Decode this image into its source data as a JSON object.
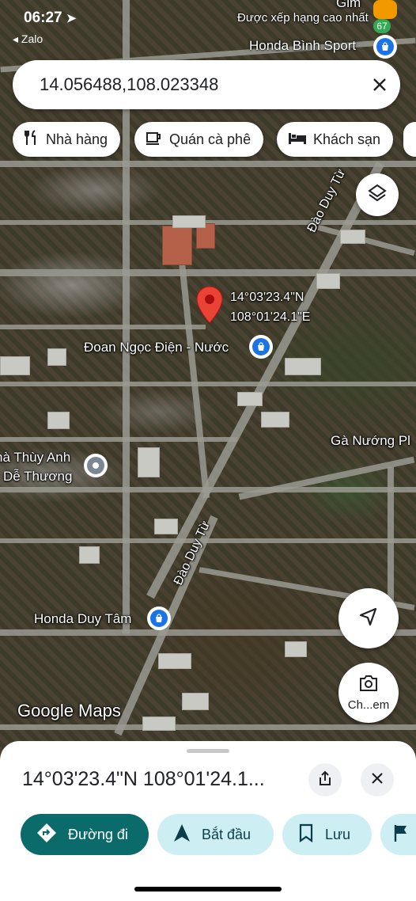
{
  "status_bar": {
    "time": "06:27",
    "back_app": "◂ Zalo",
    "top_right_text": "Được xếp hạng cao nhất",
    "badge_count": "67"
  },
  "search": {
    "value": "14.056488,108.023348"
  },
  "chips": [
    {
      "label": "Nhà hàng",
      "icon": "fork-knife-icon"
    },
    {
      "label": "Quán cà phê",
      "icon": "coffee-cup-icon"
    },
    {
      "label": "Khách sạn",
      "icon": "bed-icon"
    }
  ],
  "map": {
    "pin_coords_line1": "14°03'23.4\"N",
    "pin_coords_line2": "108°01'24.1\"E",
    "labels": {
      "honda_binh": "Honda Bình Sport",
      "doan_ngoc_dien": "Đoan Ngọc Điện - Nước",
      "ga_nuong": "Gà Nướng Pl",
      "thuy_anh_line1": "hà Thùy Anh",
      "thuy_anh_line2": "Dễ Thương",
      "honda_duy_tam": "Honda Duy Tâm",
      "road_upper": "Đào Duy Từ",
      "road_lower": "Đào Duy Từ",
      "watermark": "Google Maps",
      "checkin_label": "Ch...em",
      "top_cut": "Gim"
    }
  },
  "sheet": {
    "title": "14°03'23.4\"N 108°01'24.1...",
    "actions": [
      {
        "label": "Đường đi",
        "icon": "directions-icon"
      },
      {
        "label": "Bắt đầu",
        "icon": "navigation-arrow-icon"
      },
      {
        "label": "Lưu",
        "icon": "bookmark-icon"
      }
    ]
  },
  "colors": {
    "primary_teal": "#0b6b6b",
    "secondary_chip": "#cdeff3",
    "pin_red": "#ea4335",
    "poi_blue": "#1a73e8"
  }
}
